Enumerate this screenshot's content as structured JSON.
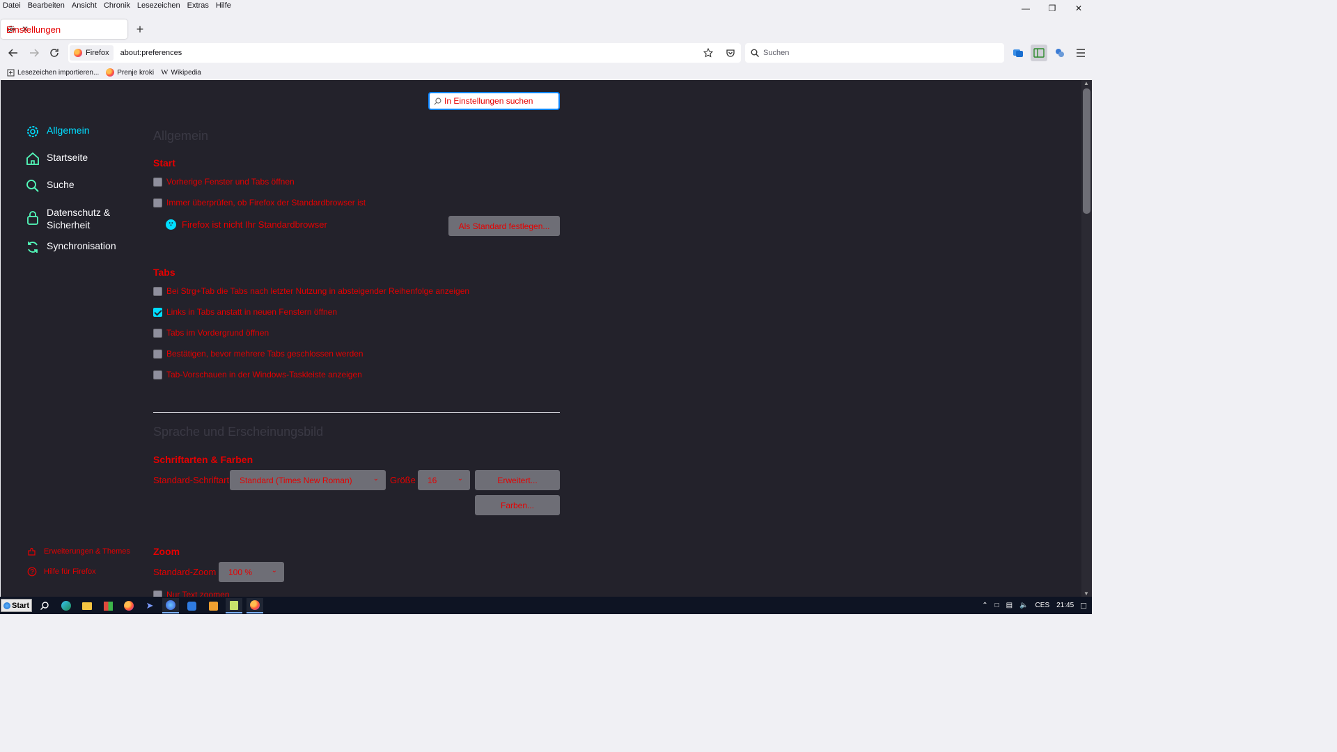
{
  "menubar": [
    "Datei",
    "Bearbeiten",
    "Ansicht",
    "Chronik",
    "Lesezeichen",
    "Extras",
    "Hilfe"
  ],
  "tab": {
    "title": "Einstellungen"
  },
  "urlbar": {
    "identity": "Firefox",
    "url": "about:preferences"
  },
  "searchbar": {
    "placeholder": "Suchen"
  },
  "bookmarks": [
    "Lesezeichen importieren...",
    "Prenje kroki",
    "Wikipedia"
  ],
  "prefs_search": {
    "placeholder": "In Einstellungen suchen"
  },
  "nav": {
    "items": [
      {
        "label": "Allgemein",
        "icon": "gear-icon",
        "active": true
      },
      {
        "label": "Startseite",
        "icon": "home-icon"
      },
      {
        "label": "Suche",
        "icon": "search-icon"
      },
      {
        "label": "Datenschutz & Sicherheit",
        "icon": "lock-icon"
      },
      {
        "label": "Synchronisation",
        "icon": "sync-icon"
      }
    ],
    "bottom": [
      {
        "label": "Erweiterungen & Themes",
        "icon": "puzzle-icon"
      },
      {
        "label": "Hilfe für Firefox",
        "icon": "help-icon"
      }
    ]
  },
  "general": {
    "heading": "Allgemein",
    "start": {
      "heading": "Start",
      "restore_session": {
        "label": "Vorherige Fenster und Tabs öffnen",
        "checked": false
      },
      "check_default": {
        "label": "Immer überprüfen, ob Firefox der Standardbrowser ist",
        "checked": false
      },
      "not_default": "Firefox ist nicht Ihr Standardbrowser",
      "set_default_button": "Als Standard festlegen..."
    },
    "tabs": {
      "heading": "Tabs",
      "options": [
        {
          "label": "Bei Strg+Tab die Tabs nach letzter Nutzung in absteigender Reihenfolge anzeigen",
          "checked": false
        },
        {
          "label": "Links in Tabs anstatt in neuen Fenstern öffnen",
          "checked": true
        },
        {
          "label": "Tabs im Vordergrund öffnen",
          "checked": false
        },
        {
          "label": "Bestätigen, bevor mehrere Tabs geschlossen werden",
          "checked": false
        },
        {
          "label": "Tab-Vorschauen in der Windows-Taskleiste anzeigen",
          "checked": false
        }
      ]
    }
  },
  "language": {
    "heading": "Sprache und Erscheinungsbild",
    "fonts": {
      "heading": "Schriftarten & Farben",
      "font_label": "Standard-Schriftart",
      "font_value": "Standard (Times New Roman)",
      "size_label": "Größe",
      "size_value": "16",
      "advanced_button": "Erweitert...",
      "colors_button": "Farben..."
    },
    "zoom": {
      "heading": "Zoom",
      "label": "Standard-Zoom",
      "value": "100 %",
      "text_only": "Nur Text zoomen"
    }
  },
  "taskbar": {
    "start": "Start",
    "tray": {
      "language": "CES",
      "time": "21:45"
    }
  },
  "colors": {
    "accent": "#00ddff",
    "content_bg": "#23222b",
    "label_red": "#e60000"
  }
}
